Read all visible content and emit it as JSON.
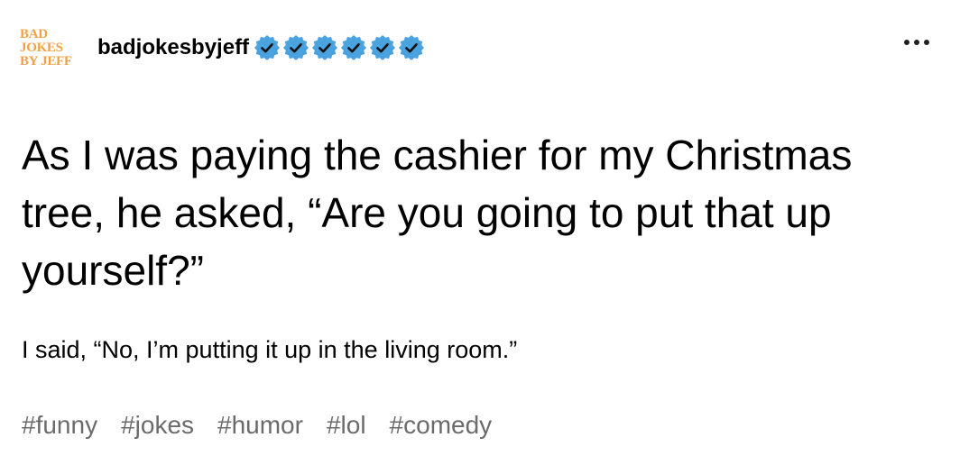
{
  "author": {
    "avatar_lines": [
      "BAD",
      "JOKES",
      "BY JEFF"
    ],
    "username": "badjokesbyjeff",
    "badge_icon": "verified-check-badge-icon",
    "badge_color": "#4aa3df",
    "badge_count": 6
  },
  "menu": {
    "icon": "more-options-icon"
  },
  "post": {
    "headline": "As I was paying the cashier for my Christmas tree, he asked, “Are you going to put that up yourself?”",
    "body": "I said, “No, I’m putting it up in the living room.”"
  },
  "tags": [
    "#funny",
    "#jokes",
    "#humor",
    "#lol",
    "#comedy"
  ]
}
